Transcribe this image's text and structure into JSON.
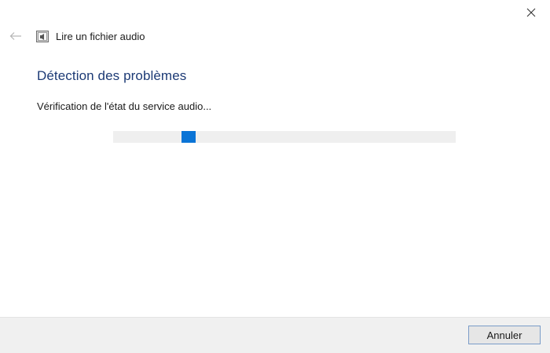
{
  "window": {
    "title": "Lire un fichier audio",
    "close_icon": "close-icon",
    "back_icon": "back-arrow-icon",
    "app_icon": "audio-troubleshooter-icon"
  },
  "main": {
    "heading": "Détection des problèmes",
    "status": "Vérification de l'état du service audio..."
  },
  "progress": {
    "mode": "indeterminate",
    "position_percent": 22,
    "track_color": "#efefef",
    "fill_color": "#0a74d6"
  },
  "footer": {
    "cancel_label": "Annuler"
  },
  "colors": {
    "accent": "#0a74d6",
    "heading": "#1c3a75",
    "footer_bg": "#f0f0f0"
  }
}
